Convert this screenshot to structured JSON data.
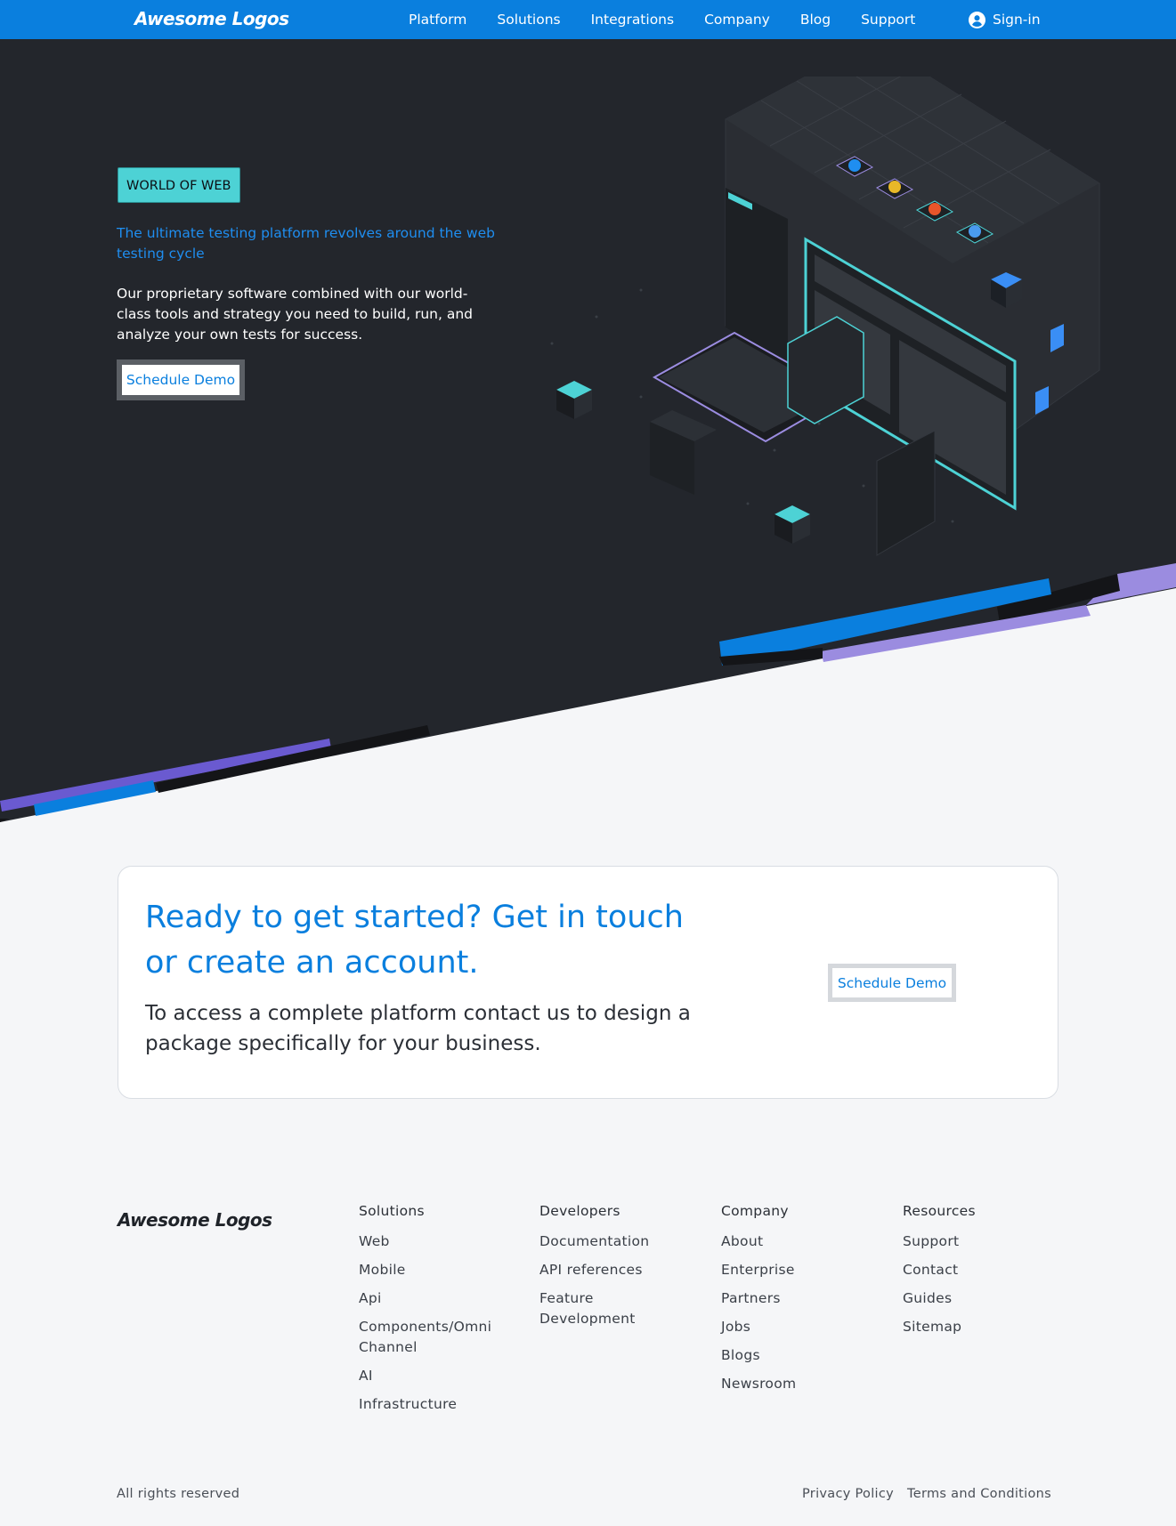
{
  "nav": {
    "logo": "Awesome Logos",
    "links": [
      "Platform",
      "Solutions",
      "Integrations",
      "Company",
      "Blog",
      "Support"
    ],
    "signin": "Sign-in"
  },
  "hero": {
    "badge": "WORLD OF WEB",
    "tagline": "The ultimate testing platform revolves around the web testing cycle",
    "description": "Our proprietary software combined with our world-class tools and strategy you need to build, run, and analyze your own tests for success.",
    "button": "Schedule Demo"
  },
  "cta": {
    "title": "Ready to get started? Get in touch or create an account.",
    "description": "To access a complete platform contact us to design a package specifically for your business.",
    "button": "Schedule Demo"
  },
  "footer": {
    "logo": "Awesome Logos",
    "columns": [
      {
        "title": "Solutions",
        "links": [
          "Web",
          "Mobile",
          "Api",
          "Components/Omni Channel",
          "AI",
          "Infrastructure"
        ]
      },
      {
        "title": "Developers",
        "links": [
          "Documentation",
          "API references",
          "Feature Development"
        ]
      },
      {
        "title": "Company",
        "links": [
          "About",
          "Enterprise",
          "Partners",
          "Jobs",
          "Blogs",
          "Newsroom"
        ]
      },
      {
        "title": "Resources",
        "links": [
          "Support",
          "Contact",
          "Guides",
          "Sitemap"
        ]
      }
    ],
    "rights": "All rights reserved",
    "legal": [
      "Privacy Policy",
      "Terms and Conditions"
    ]
  },
  "colors": {
    "brand": "#0a7fde",
    "hero_bg": "#23262c",
    "badge": "#4dd2d5",
    "accent_purple": "#9b8ce0"
  },
  "icons": {
    "signin": "user-circle-icon",
    "illustration": "isometric-web-platform-illustration"
  }
}
